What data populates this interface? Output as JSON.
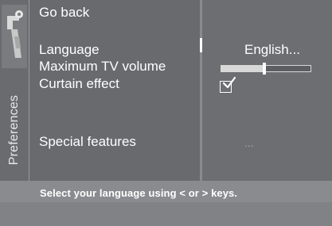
{
  "sidebar": {
    "label": "Preferences",
    "icon": "wrench-icon"
  },
  "menu": {
    "go_back": "Go back",
    "language": "Language",
    "maximum_tv_volume": "Maximum TV volume",
    "curtain_effect": "Curtain effect",
    "special_features": "Special features"
  },
  "values": {
    "language": "English...",
    "maximum_tv_volume_level": 0.48,
    "curtain_effect_checked": true,
    "special_features": "..."
  },
  "hint": {
    "text": "Select your language using < or > keys."
  },
  "colors": {
    "panel": "#696a6e",
    "background": "#2c2d31",
    "bottom_bar": "#8a8b8f",
    "text": "#ffffff"
  }
}
